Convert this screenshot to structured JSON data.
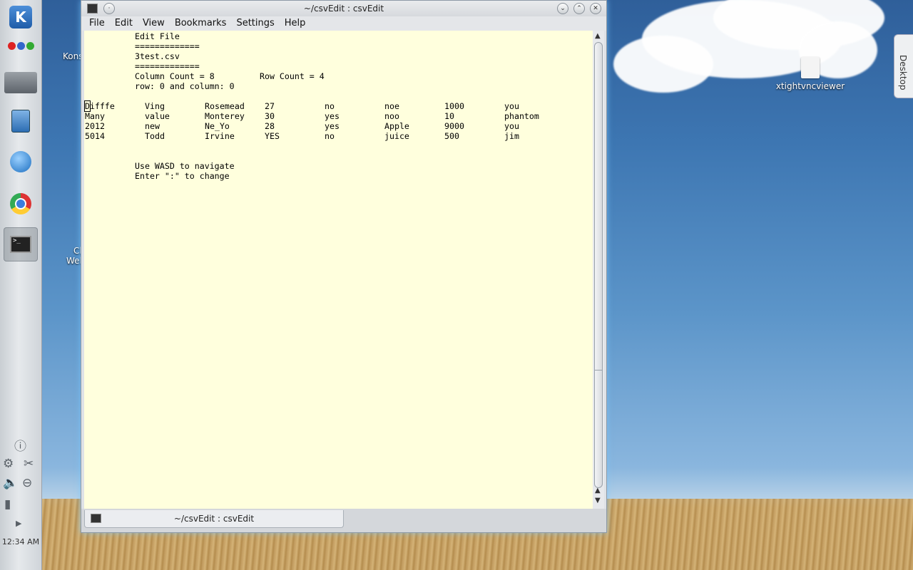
{
  "window": {
    "title": "~/csvEdit : csvEdit",
    "menu": [
      "File",
      "Edit",
      "View",
      "Bookmarks",
      "Settings",
      "Help"
    ]
  },
  "terminal": {
    "header_lines": [
      "Edit File",
      "=============",
      "3test.csv",
      "=============",
      "Column Count = 8",
      "Row Count = 4",
      "row: 0 and column: 0"
    ],
    "rows": [
      [
        "Difffe",
        "Ving",
        "Rosemead",
        "27",
        "no",
        "noe",
        "1000",
        "you"
      ],
      [
        "Many",
        "value",
        "Monterey",
        "30",
        "yes",
        "noo",
        "10",
        "phantom"
      ],
      [
        "2012",
        "new",
        "Ne_Yo",
        "28",
        "yes",
        "Apple",
        "9000",
        "you"
      ],
      [
        "5014",
        "Todd",
        "Irvine",
        "YES",
        "no",
        "juice",
        "500",
        "jim"
      ]
    ],
    "footer_lines": [
      "Use WASD to navigate",
      "Enter \":\" to change"
    ]
  },
  "tab": {
    "label": "~/csvEdit : csvEdit"
  },
  "desktop": {
    "icon_label": "xtightvncviewer",
    "side_tab": "Desktop",
    "partial_labels": [
      "Kons",
      "Ch",
      "Web"
    ]
  },
  "panel": {
    "clock": "12:34 AM"
  },
  "icons": [
    "kde-menu-icon",
    "window-dots-icon",
    "show-desktop-icon",
    "file-manager-icon",
    "web-browser-icon",
    "chrome-icon",
    "terminal-icon",
    "info-icon",
    "settings-icon",
    "cut-icon",
    "volume-icon",
    "usb-icon",
    "battery-icon",
    "expand-arrow-icon"
  ],
  "colors": {
    "terminal_bg": "#ffffdd",
    "window_glow": "#78c8ff"
  }
}
